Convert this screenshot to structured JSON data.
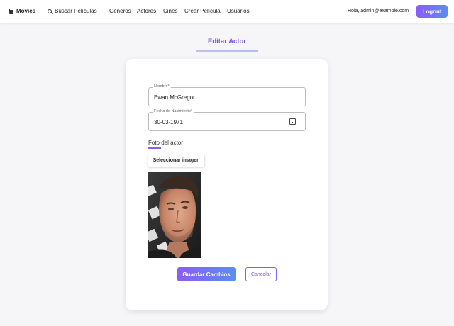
{
  "nav": {
    "brand": "Movies",
    "brand_icon": "movie-icon",
    "search_label": "Buscar Películas",
    "search_icon": "search-icon",
    "links": [
      "Géneros",
      "Actores",
      "Cines",
      "Crear Película",
      "Usuarios"
    ],
    "greeting": "Hola, admin@example.com",
    "logout_label": "Logout"
  },
  "page": {
    "title": "Editar Actor"
  },
  "form": {
    "name_label": "Nombre*",
    "name_value": "Ewan McGregor",
    "birth_label": "Fecha de Nacimiento*",
    "birth_value": "30-03-1971",
    "birth_icon": "calendar-icon",
    "photo_label": "Foto del actor",
    "select_image_label": "Seleccionar imagen",
    "save_label": "Guardar Cambios",
    "cancel_label": "Cancelar"
  },
  "colors": {
    "accent": "#8b5cf6",
    "accent_gradient_end": "#5b8def",
    "title_color": "#7a53d9"
  }
}
